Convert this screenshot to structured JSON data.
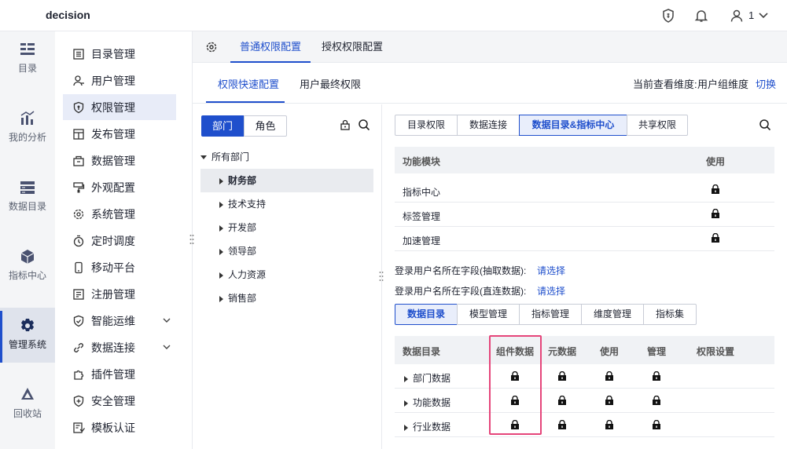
{
  "app": {
    "name": "decision"
  },
  "topbar": {
    "user_label": "1"
  },
  "rail": {
    "items": [
      {
        "label": "目录",
        "icon": "list-icon"
      },
      {
        "label": "我的分析",
        "icon": "chart-icon"
      },
      {
        "label": "数据目录",
        "icon": "database-icon"
      },
      {
        "label": "指标中心",
        "icon": "cubes-icon"
      },
      {
        "label": "管理系统",
        "icon": "gear-icon",
        "active": true
      },
      {
        "label": "回收站",
        "icon": "recycle-icon"
      }
    ]
  },
  "menu": {
    "items": [
      {
        "label": "目录管理"
      },
      {
        "label": "用户管理"
      },
      {
        "label": "权限管理",
        "active": true
      },
      {
        "label": "发布管理"
      },
      {
        "label": "数据管理"
      },
      {
        "label": "外观配置"
      },
      {
        "label": "系统管理"
      },
      {
        "label": "定时调度"
      },
      {
        "label": "移动平台"
      },
      {
        "label": "注册管理"
      },
      {
        "label": "智能运维",
        "expandable": true
      },
      {
        "label": "数据连接",
        "expandable": true
      },
      {
        "label": "插件管理"
      },
      {
        "label": "安全管理"
      },
      {
        "label": "模板认证"
      }
    ]
  },
  "tabs_primary": [
    {
      "label": "普通权限配置",
      "active": true
    },
    {
      "label": "授权权限配置"
    }
  ],
  "tabs_secondary": [
    {
      "label": "权限快速配置",
      "active": true
    },
    {
      "label": "用户最终权限"
    }
  ],
  "dimension": {
    "label": "当前查看维度:",
    "value": "用户组维度",
    "switch": "切换"
  },
  "left": {
    "segments": [
      {
        "label": "部门",
        "active": true
      },
      {
        "label": "角色"
      }
    ],
    "tree": {
      "root": "所有部门",
      "children": [
        {
          "label": "财务部",
          "selected": true
        },
        {
          "label": "技术支持"
        },
        {
          "label": "开发部"
        },
        {
          "label": "领导部"
        },
        {
          "label": "人力资源"
        },
        {
          "label": "销售部"
        }
      ]
    }
  },
  "perm_tabs": [
    {
      "label": "目录权限"
    },
    {
      "label": "数据连接"
    },
    {
      "label": "数据目录&指标中心",
      "active": true
    },
    {
      "label": "共享权限"
    }
  ],
  "module_table": {
    "headers": [
      "功能模块",
      "使用"
    ],
    "rows": [
      {
        "name": "指标中心",
        "locked": true
      },
      {
        "name": "标签管理",
        "locked": true
      },
      {
        "name": "加速管理",
        "locked": true
      }
    ]
  },
  "login_fields": [
    {
      "label": "登录用户名所在字段(抽取数据):",
      "action": "请选择"
    },
    {
      "label": "登录用户名所在字段(直连数据):",
      "action": "请选择"
    }
  ],
  "sub_tabs": [
    {
      "label": "数据目录",
      "active": true
    },
    {
      "label": "模型管理"
    },
    {
      "label": "指标管理"
    },
    {
      "label": "维度管理"
    },
    {
      "label": "指标集"
    }
  ],
  "catalog_table": {
    "headers": [
      "数据目录",
      "组件数据",
      "元数据",
      "使用",
      "管理",
      "权限设置"
    ],
    "rows": [
      {
        "name": "部门数据"
      },
      {
        "name": "功能数据"
      },
      {
        "name": "行业数据"
      }
    ]
  },
  "colors": {
    "accent": "#1f4fcc",
    "highlight": "#e5457a"
  }
}
